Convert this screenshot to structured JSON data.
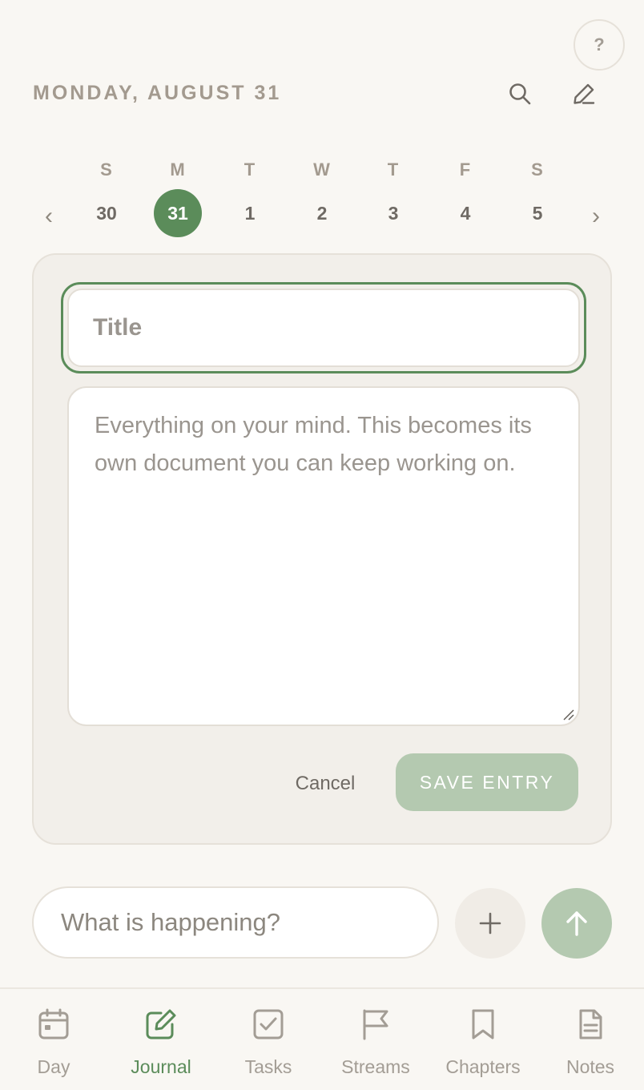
{
  "header": {
    "date": "MONDAY, AUGUST 31",
    "help_label": "?"
  },
  "week": {
    "days": [
      {
        "letter": "S",
        "num": "30"
      },
      {
        "letter": "M",
        "num": "31"
      },
      {
        "letter": "T",
        "num": "1"
      },
      {
        "letter": "W",
        "num": "2"
      },
      {
        "letter": "T",
        "num": "3"
      },
      {
        "letter": "F",
        "num": "4"
      },
      {
        "letter": "S",
        "num": "5"
      }
    ],
    "prev_arrow": "‹",
    "next_arrow": "›"
  },
  "entry": {
    "title_placeholder": "Title",
    "body_placeholder": "Everything on your mind. This becomes its own document you can keep working on.",
    "cancel_label": "Cancel",
    "save_label": "SAVE ENTRY"
  },
  "composer": {
    "placeholder": "What is happening?"
  },
  "tabs": [
    {
      "label": "Day",
      "icon": "calendar-icon"
    },
    {
      "label": "Journal",
      "icon": "pencil-square-icon"
    },
    {
      "label": "Tasks",
      "icon": "checkbox-icon"
    },
    {
      "label": "Streams",
      "icon": "flag-icon"
    },
    {
      "label": "Chapters",
      "icon": "bookmark-icon"
    },
    {
      "label": "Notes",
      "icon": "document-icon"
    }
  ],
  "colors": {
    "accent": "#5b8c5a",
    "accent_muted": "#b4c9b0",
    "background": "#f9f7f3",
    "card": "#f2efea"
  }
}
